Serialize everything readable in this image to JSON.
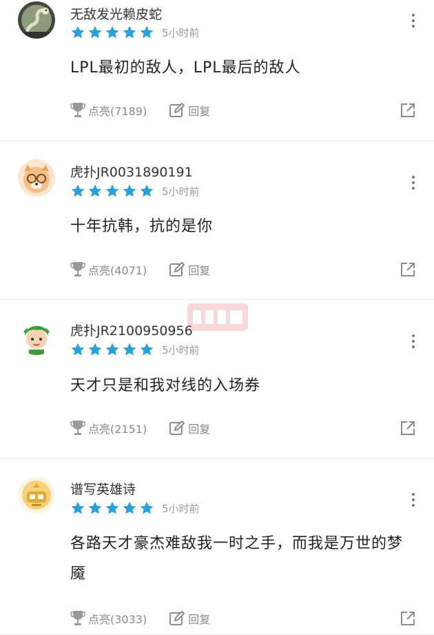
{
  "accent_star_color": "#2da0d6",
  "comments": [
    {
      "username": "无敌发光赖皮蛇",
      "avatar": "snake-character-avatar",
      "time": "5小时前",
      "content": "LPL最初的敌人，LPL最后的敌人",
      "like_label": "点亮(7189)",
      "reply_label": "回复",
      "stars": 5
    },
    {
      "username": "虎扑JR0031890191",
      "avatar": "cartoon-dog-with-glasses-avatar",
      "time": "5小时前",
      "content": "十年抗韩，抗的是你",
      "like_label": "点亮(4071)",
      "reply_label": "回复",
      "stars": 5
    },
    {
      "username": "虎扑JR2100950956",
      "avatar": "green-hair-boy-avatar",
      "time": "5小时前",
      "content": "天才只是和我对线的入场券",
      "like_label": "点亮(2151)",
      "reply_label": "回复",
      "stars": 5
    },
    {
      "username": "谱写英雄诗",
      "avatar": "yellow-robot-avatar",
      "time": "5小时前",
      "content": "各路天才豪杰难敌我一时之手，而我是万世的梦魇",
      "like_label": "点亮(3033)",
      "reply_label": "回复",
      "stars": 5
    }
  ]
}
